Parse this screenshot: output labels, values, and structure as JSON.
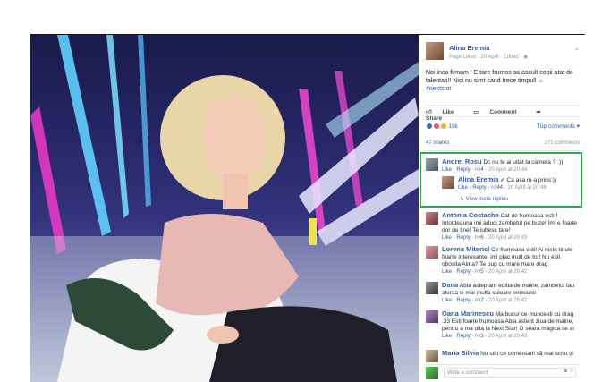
{
  "post": {
    "author": "Alina Eremia",
    "meta": "Page Liked · 20 April · Edited · ",
    "text": "Noi inca filmam ! E tare frumos sa ascult copii atat de talentati!! Nici nu simt cand trece timpul!",
    "hashtag": "#nextstar"
  },
  "actions": {
    "like": "Like",
    "comment": "Comment",
    "share": "Share"
  },
  "reactions": {
    "count": "19k",
    "top_comments": "Top comments ▾"
  },
  "stats": {
    "shares": "47 shares",
    "comments": "275 comments"
  },
  "highlighted_comments": [
    {
      "author": "Andrei Rosu",
      "text": "Dc nu te ai uitat la camera ? :))",
      "like": "Like",
      "reply": "Reply",
      "likes": "4",
      "time": "20 April at 20:44"
    },
    {
      "author": "Alina Eremia",
      "text": "Ca asa m-a prins:))",
      "like": "Like",
      "reply": "Reply",
      "likes": "44",
      "time": "20 April at 20:48"
    }
  ],
  "view_more": "View more replies",
  "comments": [
    {
      "author": "Antonia Costache",
      "text": "Cat de frumoasa esti!! Intotdeauna imi aduci zambetul pe buze! Imi e foarte dor de tine! Te iubesc tare!",
      "like": "Like",
      "reply": "Reply",
      "likes": "6",
      "time": "20 April at 20:43"
    },
    {
      "author": "Lorena Mitericl",
      "text": "Ce frumoasa esti! Ai niste tinute foarte interesante, imi plac mult de tot! Nu esti obosita Alina? Te pup cu mare mare drag",
      "like": "Like",
      "reply": "Reply",
      "likes": "5",
      "time": "20 April at 20:42"
    },
    {
      "author": "Dana",
      "text": "Abia asteptam editia de maine, zambetul tau aleraa si mai multa culoare emisiunii",
      "like": "Like",
      "reply": "Reply",
      "likes": "2",
      "time": "20 April at 20:42"
    },
    {
      "author": "Oana Marinescu",
      "text": "Ma bucur ce munceeti cu drag :33 Esti foarte frumoasa Abia astept ziua de maine, pentru a ma uita la Next Star! O seara magica se ai",
      "like": "Like",
      "reply": "Reply",
      "likes": "3",
      "time": "20 April at 20:43"
    },
    {
      "author": "Maria Silvia",
      "text": "Nu stiu ce comentarii să mai scriu și",
      "like": "",
      "reply": "",
      "likes": "",
      "time": ""
    }
  ],
  "write_placeholder": "Write a comment",
  "colors": {
    "link": "#365899",
    "highlight": "#2fa84f"
  }
}
